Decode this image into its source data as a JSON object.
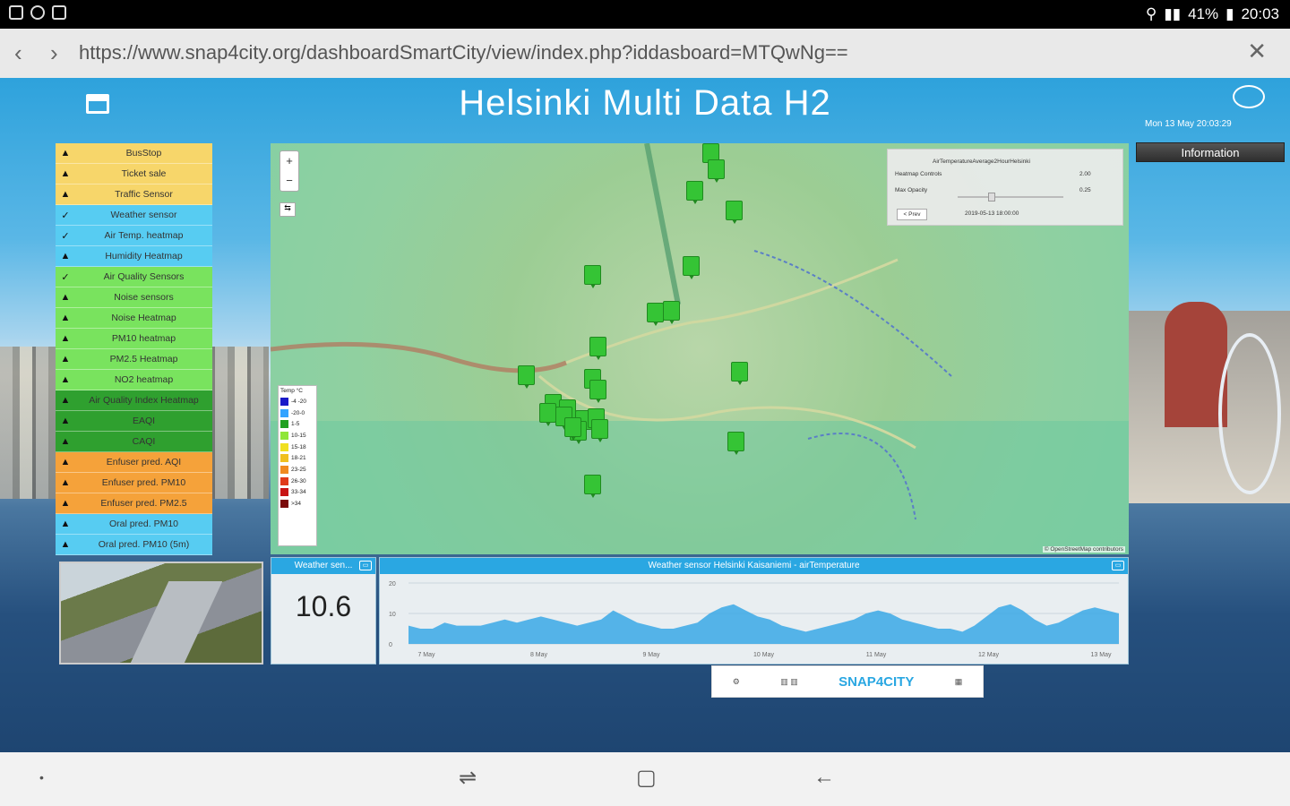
{
  "status": {
    "battery": "41%",
    "time": "20:03"
  },
  "browser": {
    "url": "https://www.snap4city.org/dashboardSmartCity/view/index.php?iddasboard=MTQwNg==",
    "back": "‹",
    "forward": "›",
    "close": "✕"
  },
  "dashboard": {
    "title": "Helsinki Multi Data H2",
    "datetime": "Mon 13 May 20:03:29",
    "info_button": "Information"
  },
  "menu": [
    {
      "label": "BusStop",
      "color": "#f7d66a",
      "icon": "▲"
    },
    {
      "label": "Ticket sale",
      "color": "#f7d66a",
      "icon": "▲"
    },
    {
      "label": "Traffic Sensor",
      "color": "#f7d66a",
      "icon": "▲"
    },
    {
      "label": "Weather sensor",
      "color": "#57ccf2",
      "icon": "✓"
    },
    {
      "label": "Air Temp. heatmap",
      "color": "#57ccf2",
      "icon": "✓"
    },
    {
      "label": "Humidity Heatmap",
      "color": "#57ccf2",
      "icon": "▲"
    },
    {
      "label": "Air Quality Sensors",
      "color": "#79e35e",
      "icon": "✓"
    },
    {
      "label": "Noise sensors",
      "color": "#79e35e",
      "icon": "▲"
    },
    {
      "label": "Noise Heatmap",
      "color": "#79e35e",
      "icon": "▲"
    },
    {
      "label": "PM10 heatmap",
      "color": "#79e35e",
      "icon": "▲"
    },
    {
      "label": "PM2.5 Heatmap",
      "color": "#79e35e",
      "icon": "▲"
    },
    {
      "label": "NO2 heatmap",
      "color": "#79e35e",
      "icon": "▲"
    },
    {
      "label": "Air Quality Index Heatmap",
      "color": "#2fa02f",
      "icon": "▲"
    },
    {
      "label": "EAQI",
      "color": "#2fa02f",
      "icon": "▲"
    },
    {
      "label": "CAQI",
      "color": "#2fa02f",
      "icon": "▲"
    },
    {
      "label": "Enfuser pred. AQI",
      "color": "#f5a23a",
      "icon": "▲"
    },
    {
      "label": "Enfuser pred. PM10",
      "color": "#f5a23a",
      "icon": "▲"
    },
    {
      "label": "Enfuser pred. PM2.5",
      "color": "#f5a23a",
      "icon": "▲"
    },
    {
      "label": "Oral pred. PM10",
      "color": "#57ccf2",
      "icon": "▲"
    },
    {
      "label": "Oral pred. PM10 (5m)",
      "color": "#57ccf2",
      "icon": "▲"
    }
  ],
  "map": {
    "zoom_in": "+",
    "zoom_out": "−",
    "layers": "⇆",
    "attribution": "© OpenStreetMap contributors",
    "heatmap": {
      "title": "AirTemperatureAverage2HourHelsinki",
      "controls_label": "Heatmap Controls",
      "controls_value": "2.00",
      "opacity_label": "Max Opacity",
      "opacity_value": "0.25",
      "prev_label": "< Prev",
      "date": "2019-05-13 18:00:00"
    },
    "legend": {
      "title": "Temp °C",
      "items": [
        {
          "label": "-4 -20",
          "color": "#1a1ac8"
        },
        {
          "label": "-20-0",
          "color": "#33a3ff"
        },
        {
          "label": "1-5",
          "color": "#21a021"
        },
        {
          "label": "10-15",
          "color": "#8fe63a"
        },
        {
          "label": "15-18",
          "color": "#f0e020"
        },
        {
          "label": "18-21",
          "color": "#f0c020"
        },
        {
          "label": "23-25",
          "color": "#f08a20"
        },
        {
          "label": "26-30",
          "color": "#e03a1a"
        },
        {
          "label": "33-34",
          "color": "#c81414"
        },
        {
          "label": ">34",
          "color": "#7a0a0a"
        }
      ]
    }
  },
  "weather_widget": {
    "title": "Weather sen...",
    "value": "10.6"
  },
  "chart_widget": {
    "title": "Weather sensor Helsinki Kaisaniemi - airTemperature",
    "chart_data": {
      "type": "area",
      "title": "Weather sensor Helsinki Kaisaniemi - airTemperature",
      "y_ticks": [
        "20",
        "10",
        "0"
      ],
      "ylim": [
        0,
        20
      ],
      "x_ticks": [
        "7 May",
        "8 May",
        "9 May",
        "10 May",
        "11 May",
        "12 May",
        "13 May"
      ],
      "series": [
        {
          "color": "#3aa8e6",
          "values": [
            6,
            5,
            5,
            7,
            6,
            6,
            6,
            7,
            8,
            7,
            8,
            9,
            8,
            7,
            6,
            7,
            8,
            11,
            9,
            7,
            6,
            5,
            5,
            6,
            7,
            10,
            12,
            13,
            11,
            9,
            8,
            6,
            5,
            4,
            5,
            6,
            7,
            8,
            10,
            11,
            10,
            8,
            7,
            6,
            5,
            5,
            4,
            6,
            9,
            12,
            13,
            11,
            8,
            6,
            7,
            9,
            11,
            12,
            11,
            10
          ]
        }
      ],
      "grid": true,
      "legend": "none"
    }
  },
  "logos": {
    "snap": "SNAP4CITY"
  },
  "navbar": {
    "recent": "⇌",
    "home": "▢",
    "back": "←",
    "dot": "•"
  }
}
